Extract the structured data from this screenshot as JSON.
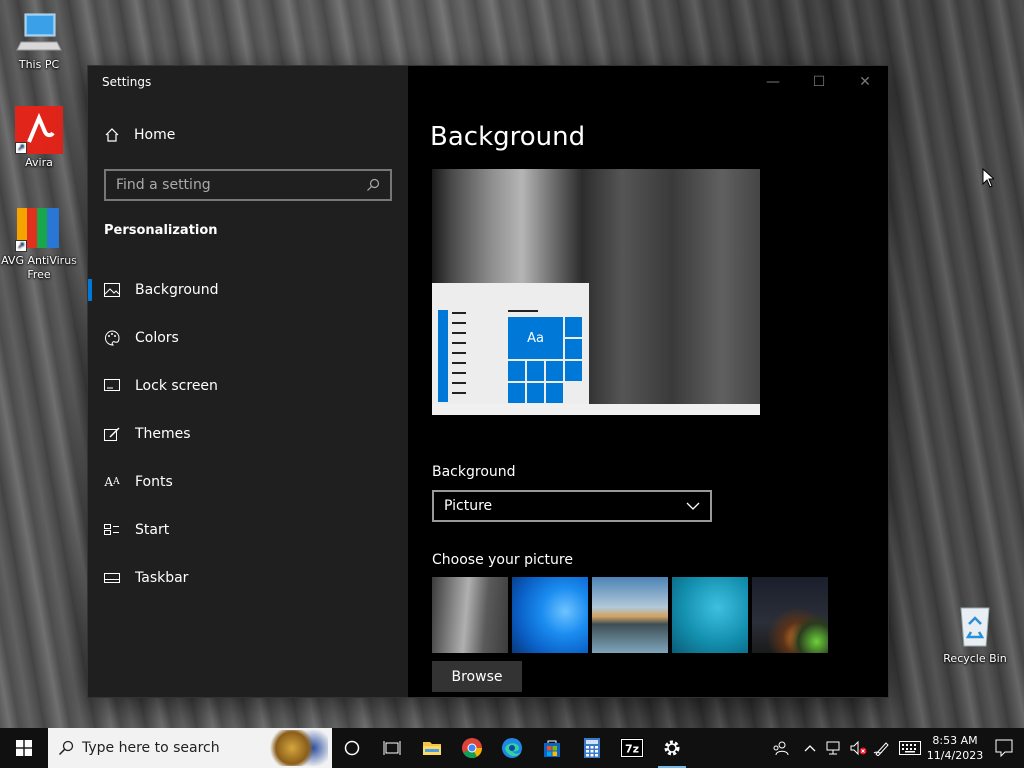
{
  "desktop": {
    "icons": [
      {
        "label": "This PC"
      },
      {
        "label": "Avira"
      },
      {
        "label": "AVG AntiVirus Free"
      },
      {
        "label": "Recycle Bin"
      }
    ]
  },
  "window": {
    "title": "Settings",
    "controls": {
      "minimize": "—",
      "maximize": "☐",
      "close": "✕"
    }
  },
  "sidebar": {
    "home_label": "Home",
    "search_placeholder": "Find a setting",
    "section_title": "Personalization",
    "items": [
      {
        "label": "Background",
        "icon": "picture-icon",
        "active": true
      },
      {
        "label": "Colors",
        "icon": "palette-icon"
      },
      {
        "label": "Lock screen",
        "icon": "lock-screen-icon"
      },
      {
        "label": "Themes",
        "icon": "themes-icon"
      },
      {
        "label": "Fonts",
        "icon": "fonts-icon"
      },
      {
        "label": "Start",
        "icon": "start-icon"
      },
      {
        "label": "Taskbar",
        "icon": "taskbar-icon"
      }
    ]
  },
  "main": {
    "title": "Background",
    "preview": {
      "tile_text": "Aa"
    },
    "background_label": "Background",
    "background_value": "Picture",
    "choose_label": "Choose your picture",
    "browse_label": "Browse"
  },
  "taskbar": {
    "search_placeholder": "Type here to search",
    "clock_time": "8:53 AM",
    "clock_date": "11/4/2023",
    "accent_color": "#0078d7"
  }
}
